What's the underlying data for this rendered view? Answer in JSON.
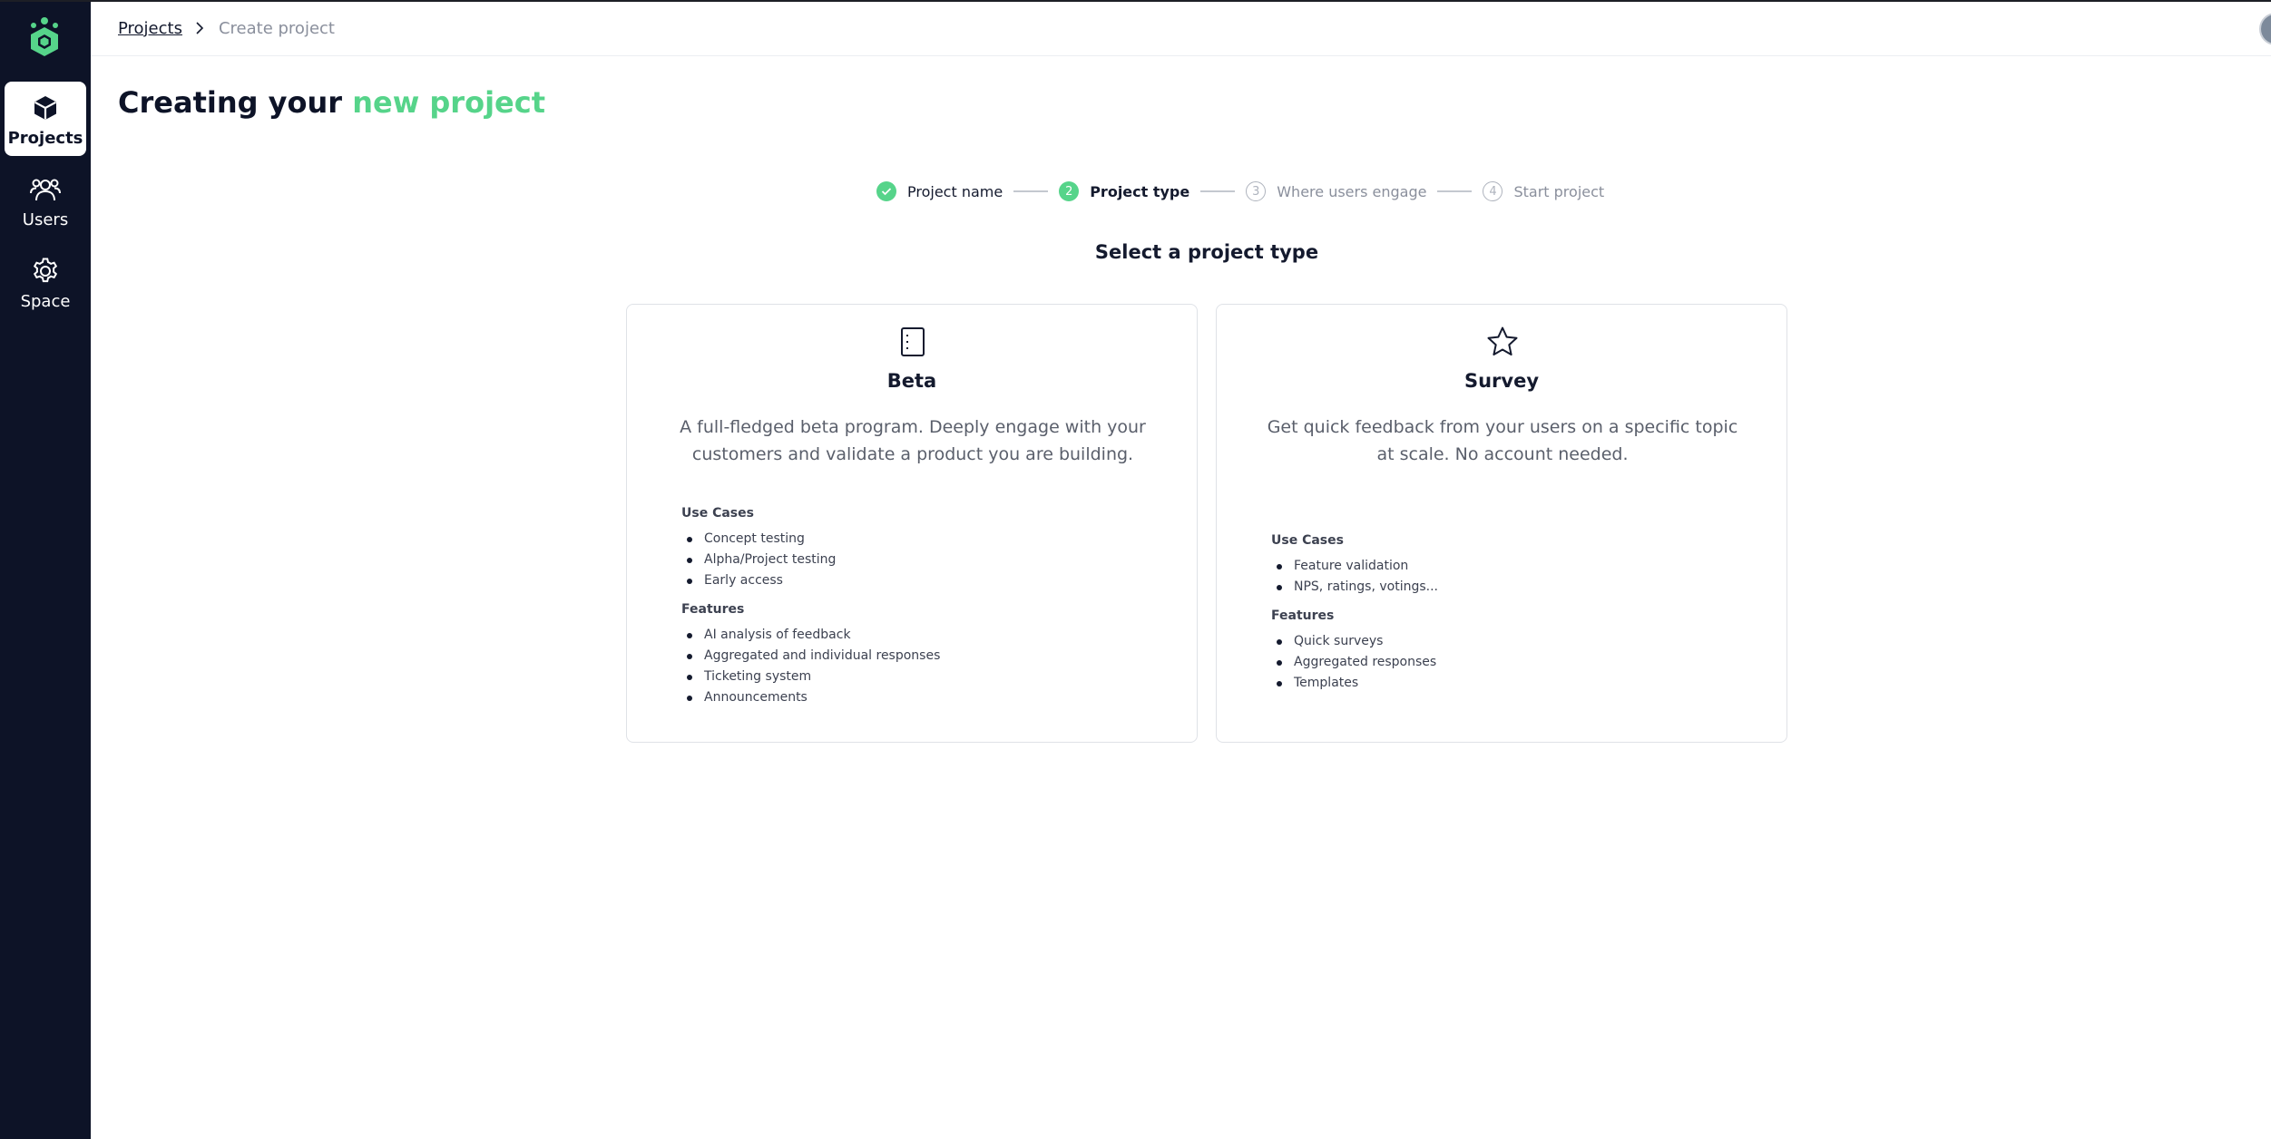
{
  "sidebar": {
    "items": [
      {
        "label": "Projects",
        "icon": "cube-icon",
        "active": true
      },
      {
        "label": "Users",
        "icon": "users-icon",
        "active": false
      },
      {
        "label": "Space",
        "icon": "gear-icon",
        "active": false
      }
    ]
  },
  "breadcrumb": {
    "link": "Projects",
    "current": "Create project"
  },
  "page": {
    "title_prefix": "Creating your",
    "title_accent": "new project",
    "section_title": "Select a project type"
  },
  "stepper": {
    "steps": [
      {
        "number": "1",
        "label": "Project name",
        "state": "done"
      },
      {
        "number": "2",
        "label": "Project type",
        "state": "current"
      },
      {
        "number": "3",
        "label": "Where users engage",
        "state": "todo"
      },
      {
        "number": "4",
        "label": "Start project",
        "state": "todo"
      }
    ]
  },
  "cards": [
    {
      "icon": "notebook-icon",
      "title": "Beta",
      "description": "A full-fledged beta program. Deeply engage with your customers and validate a product you are building.",
      "use_cases_heading": "Use Cases",
      "use_cases": [
        "Concept testing",
        "Alpha/Project testing",
        "Early access"
      ],
      "features_heading": "Features",
      "features": [
        "AI analysis of feedback",
        "Aggregated and individual responses",
        "Ticketing system",
        "Announcements"
      ]
    },
    {
      "icon": "star-icon",
      "title": "Survey",
      "description": "Get quick feedback from your users on a specific topic at scale. No account needed.",
      "use_cases_heading": "Use Cases",
      "use_cases": [
        "Feature validation",
        "NPS, ratings, votings..."
      ],
      "features_heading": "Features",
      "features": [
        "Quick surveys",
        "Aggregated responses",
        "Templates"
      ]
    }
  ],
  "colors": {
    "accent": "#56d48a",
    "sidebar_bg": "#0d1327",
    "text_dark": "#141a2e",
    "text_muted": "#8a8f9c"
  }
}
